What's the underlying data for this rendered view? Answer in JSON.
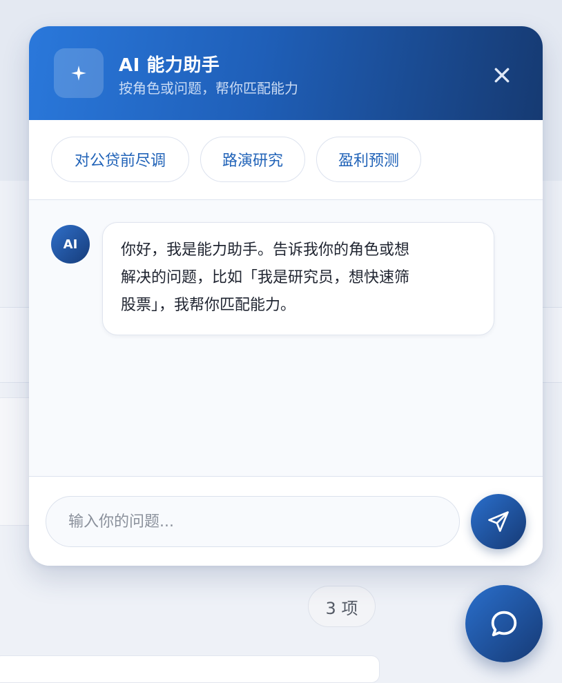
{
  "header": {
    "title": "AI 能力助手",
    "subtitle": "按角色或问题，帮你匹配能力",
    "icon": "sparkle-icon",
    "close_icon": "close-icon"
  },
  "chips": [
    {
      "label": "对公贷前尽调"
    },
    {
      "label": "路演研究"
    },
    {
      "label": "盈利预测"
    }
  ],
  "messages": [
    {
      "sender": "AI",
      "lines": [
        "你好，我是能力助手。告诉我你的角色或想",
        "解决的问题，比如「我是研究员，想快速筛",
        "股票」，我帮你匹配能力。"
      ]
    }
  ],
  "input": {
    "placeholder": "输入你的问题...",
    "value": "",
    "send_icon": "send-icon"
  },
  "background": {
    "count_badge": "3 项"
  },
  "fab": {
    "icon": "chat-bubble-icon"
  },
  "colors": {
    "header_start": "#2a78db",
    "header_end": "#163a72",
    "chip_text": "#2163b8",
    "accent_dark": "#163a75"
  }
}
